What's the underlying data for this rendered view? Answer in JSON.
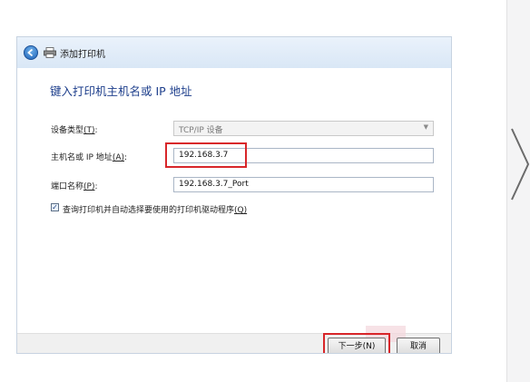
{
  "dialog": {
    "title": "添加打印机",
    "heading": "键入打印机主机名或 IP 地址"
  },
  "form": {
    "device_type_label": "设备类型",
    "device_type_key": "(T)",
    "device_type_value": "TCP/IP 设备",
    "host_label": "主机名或 IP 地址",
    "host_key": "(A)",
    "host_value": "192.168.3.7",
    "port_label": "端口名称",
    "port_key": "(P)",
    "port_value": "192.168.3.7_Port",
    "query_checkbox_label": "查询打印机并自动选择要使用的打印机驱动程序",
    "query_checkbox_key": "(Q)",
    "query_checked": true
  },
  "buttons": {
    "next_label": "下一步(N)",
    "cancel_label": "取消"
  },
  "colors": {
    "highlight": "#d8262a",
    "heading": "#1e3f8c"
  }
}
